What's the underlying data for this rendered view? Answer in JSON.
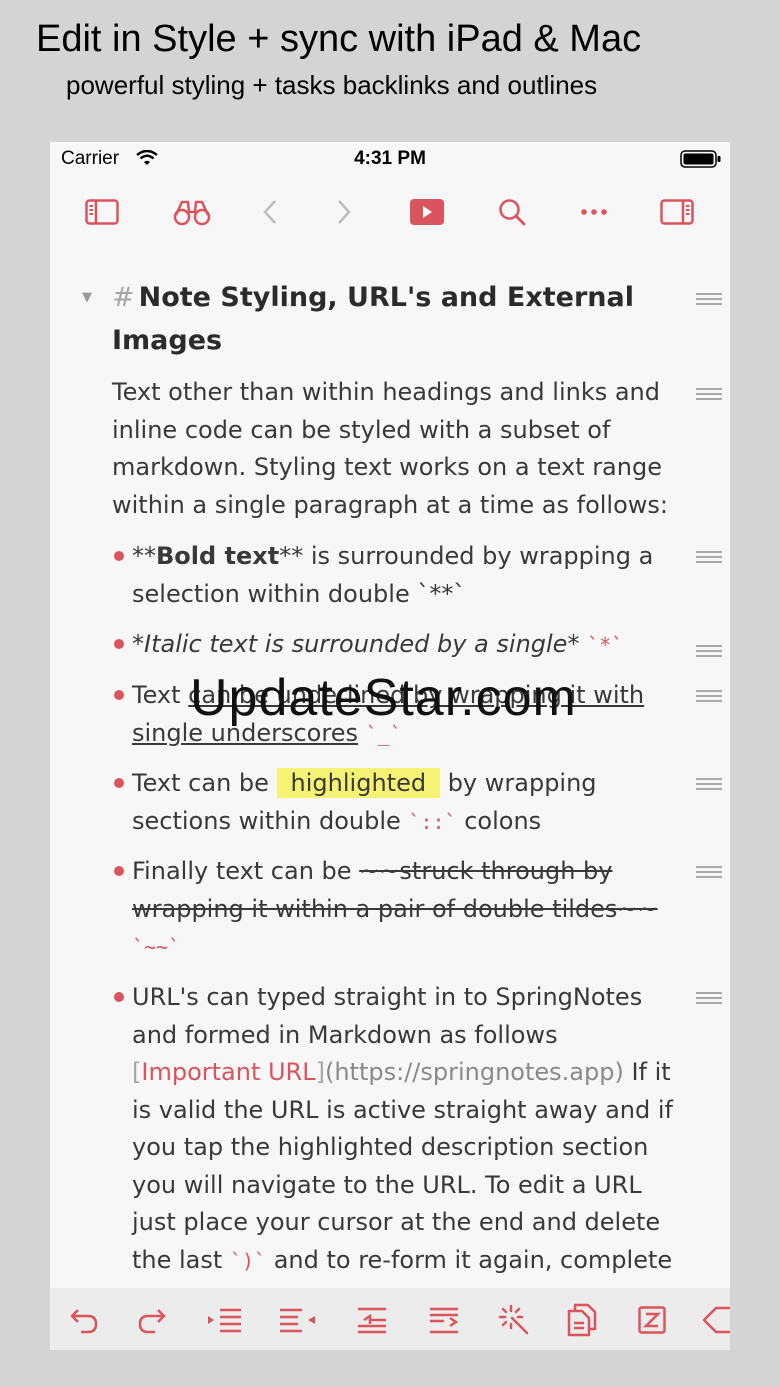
{
  "promo": {
    "title": "Edit in Style + sync with iPad & Mac",
    "subtitle": "powerful styling + tasks backlinks and outlines"
  },
  "status_bar": {
    "carrier": "Carrier",
    "time": "4:31 PM"
  },
  "toolbar": {
    "icons": [
      "sidebar-icon",
      "binoculars-icon",
      "back-chevron-icon",
      "forward-chevron-icon",
      "play-icon",
      "search-icon",
      "more-icon",
      "right-panel-icon"
    ]
  },
  "accent_color": "#d9545d",
  "highlight_color": "#f6f374",
  "note": {
    "heading_hash": "#",
    "heading": "Note Styling, URL's and External Images",
    "intro": "Text other than within headings and links and inline code can be styled with a subset of markdown. Styling text works on a text range within a single paragraph at a time as follows:",
    "bold_item": {
      "prefix": "**",
      "bold": "Bold text",
      "suffix": "** is surrounded by wrapping a selection within double ",
      "code": "`**`"
    },
    "italic_item": {
      "italic": "*Italic text is surrounded by a single*",
      "code": "`*`"
    },
    "underline_item": {
      "prefix": "Text ",
      "underlined": "can be underlined by wrapping it with single underscores",
      "code": "`_`"
    },
    "highlight_item": {
      "prefix": "Text can be ",
      "highlighted": "highlighted",
      "middle": " by wrapping sections within double ",
      "code": "`::`",
      "suffix": " colons"
    },
    "strike_item": {
      "prefix": "Finally text can be ",
      "struck": "~~struck through by wrapping it within a pair of double tildes~~",
      "code": "`~~`"
    },
    "url_item": {
      "text1": "URL's can typed straight in to SpringNotes and formed in Markdown as follows ",
      "open_bracket": "[",
      "link_text": "Important URL",
      "close_bracket": "]",
      "url": "(https://springnotes.app)",
      "text2": " If it is valid the URL is active straight away and if you tap the highlighted description section you will navigate to the URL. To edit a URL just place your cursor at the end and delete the last ",
      "code": "`)`",
      "text3": " and to re-form it again, complete"
    }
  },
  "watermark": "UpdateStar.com",
  "bottom_toolbar": {
    "icons": [
      "undo-icon",
      "redo-icon",
      "indent-icon",
      "outdent-icon",
      "move-up-icon",
      "move-down-icon",
      "magic-wand-icon",
      "copy-icon",
      "template-icon",
      "tag-icon"
    ]
  }
}
